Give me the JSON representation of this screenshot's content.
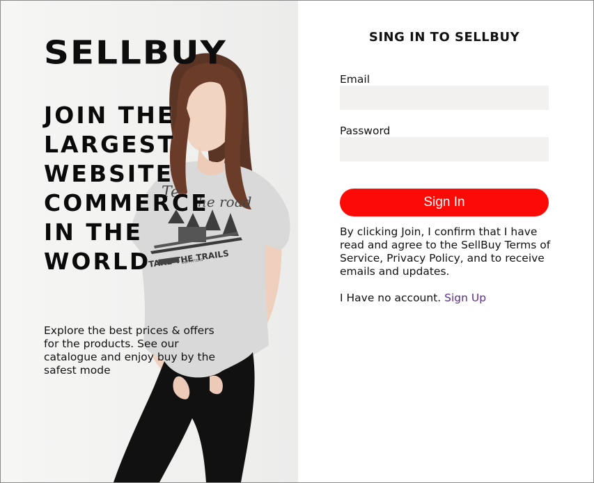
{
  "hero": {
    "logo": "SELLBUY",
    "headline_lines": [
      "JOIN THE",
      "LARGEST",
      "WEBSITE",
      "COMMERCE",
      "IN THE",
      "WORLD"
    ],
    "description": "Explore the best prices & offers for the products. See our catalogue and enjoy buy by the safest mode",
    "shirt_print_line1": "Take the road",
    "shirt_print_line2": "TAKE THE TRAILS",
    "shirt_print_line3": "OUTFITTERS"
  },
  "form": {
    "title": "SING IN TO SELLBUY",
    "email_label": "Email",
    "email_value": "",
    "password_label": "Password",
    "password_value": "",
    "signin_label": "Sign In",
    "terms": "By clicking Join, I confirm that I have read and agree to the SellBuy Terms of Service, Privacy Policy, and to receive emails and updates.",
    "no_account_text": "I Have no account.",
    "signup_label": "Sign Up"
  },
  "colors": {
    "button": "#fb0a06",
    "input_bg": "#f3f0f0",
    "link": "#5b2d8e"
  }
}
